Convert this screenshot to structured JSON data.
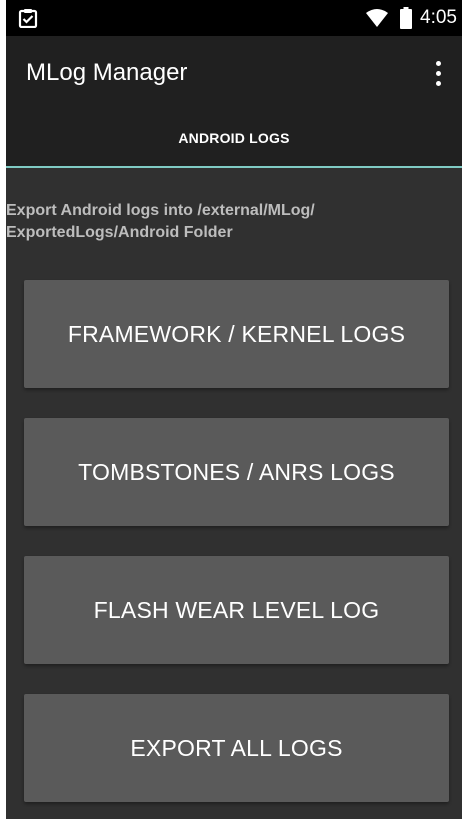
{
  "status_bar": {
    "time": "4:05",
    "left_icon": "clipboard-check-icon",
    "wifi_icon": "wifi-icon",
    "battery_icon": "battery-icon"
  },
  "app_bar": {
    "title": "MLog Manager",
    "menu_icon": "overflow-menu-icon"
  },
  "tabs": [
    {
      "label": "ANDROID LOGS",
      "selected": true
    }
  ],
  "content": {
    "description_line1": "Export Android logs into /external/MLog/",
    "description_line2": "ExportedLogs/Android Folder",
    "buttons": [
      {
        "label": "FRAMEWORK / KERNEL LOGS"
      },
      {
        "label": "TOMBSTONES / ANRS LOGS"
      },
      {
        "label": "FLASH WEAR LEVEL LOG"
      },
      {
        "label": "EXPORT ALL LOGS"
      }
    ]
  },
  "colors": {
    "app_bar_background": "#202020",
    "content_background": "#303030",
    "button_background": "#5a5a5a",
    "tab_indicator": "#80cbc4",
    "description_text": "#bdbdbd"
  }
}
